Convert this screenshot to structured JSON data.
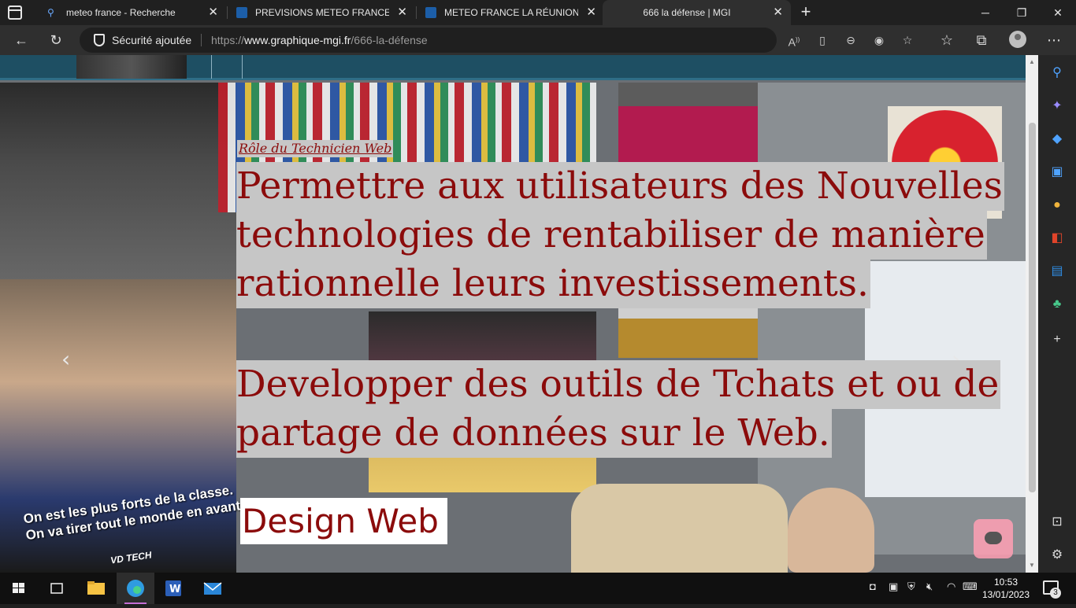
{
  "browser": {
    "tabs": [
      {
        "title": "meteo france - Recherche",
        "active": false
      },
      {
        "title": "PREVISIONS METEO FRANCE - Si",
        "active": false
      },
      {
        "title": "METEO FRANCE LA RÉUNION pa",
        "active": false
      },
      {
        "title": "666 la défense | MGI",
        "active": true
      }
    ],
    "new_tab_label": "+",
    "security_label": "Sécurité ajoutée",
    "url_prefix": "https://",
    "url_host": "www.graphique-mgi.fr",
    "url_path": "/666-la-défense",
    "window_controls": {
      "minimize": "─",
      "maximize": "❐",
      "close": "✕"
    }
  },
  "page": {
    "photo_caption_line1": "On est les plus forts de la classe.",
    "photo_caption_line2": "On va tirer tout le monde en avant.",
    "photo_brand": "VD TECH",
    "kicker": "Rôle du Technicien Web",
    "heading1": [
      "Permettre aux utilisateurs des Nouvelles",
      "technologies de rentabiliser de manière",
      "rationnelle leurs investissements."
    ],
    "heading2": [
      "Developper des outils de Tchats et ou de",
      "partage de données sur le Web."
    ],
    "design_web": "Design Web",
    "nav_prev": "‹",
    "nav_next": "›"
  },
  "taskbar": {
    "time": "10:53",
    "date": "13/01/2023",
    "notification_count": "3"
  },
  "colors": {
    "heading_text": "#8b0b0b",
    "heading_bg": "#c6c6c6",
    "header_band": "#1e4f63",
    "taskbar_accent": "#c56ed6"
  }
}
